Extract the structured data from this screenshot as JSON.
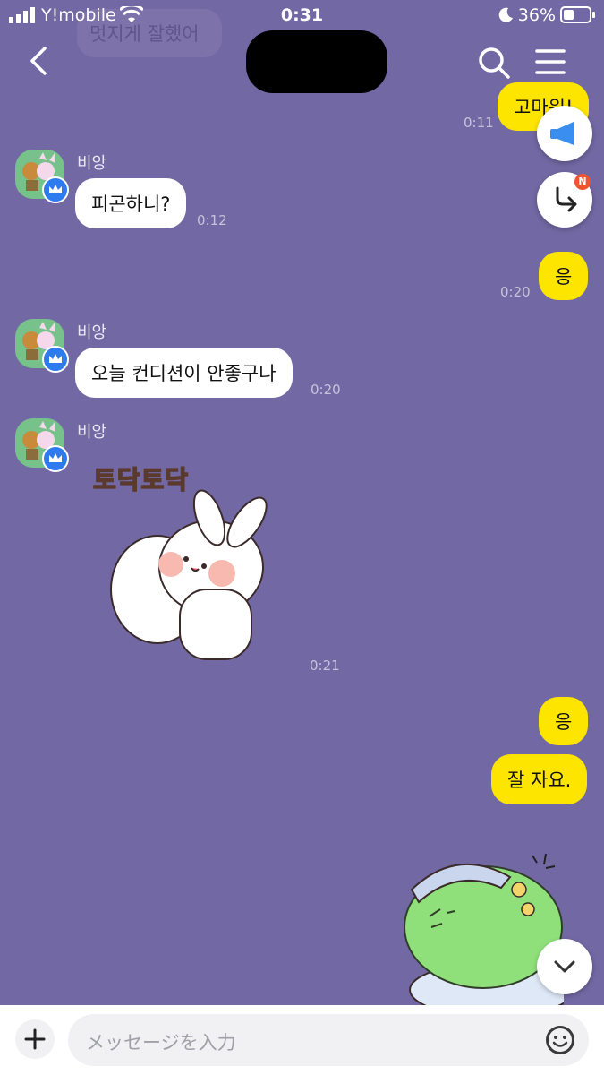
{
  "status_bar": {
    "carrier": "Y!mobile",
    "time": "0:31",
    "battery": "36%"
  },
  "header": {
    "title_redacted": true
  },
  "messages": [
    {
      "side": "me",
      "text": "멋지게 잘했어",
      "faded": true
    },
    {
      "side": "me",
      "text": "고마워!",
      "time": "0:11"
    },
    {
      "side": "them",
      "sender": "비앙",
      "text": "피곤하니?",
      "time": "0:12"
    },
    {
      "side": "me",
      "text": "응",
      "time": "0:20"
    },
    {
      "side": "them",
      "sender": "비앙",
      "text": "오늘 컨디션이 안좋구나",
      "time": "0:20"
    },
    {
      "side": "them",
      "sender": "비앙",
      "sticker_caption": "토닥토닥",
      "time": "0:21"
    },
    {
      "side": "me",
      "text": "응"
    },
    {
      "side": "me",
      "text": "잘 자요."
    }
  ],
  "input": {
    "placeholder": "メッセージを入力"
  },
  "badges": {
    "new": "N"
  },
  "colors": {
    "background": "#7268a3",
    "my_bubble": "#fee500",
    "their_bubble": "#ffffff"
  }
}
